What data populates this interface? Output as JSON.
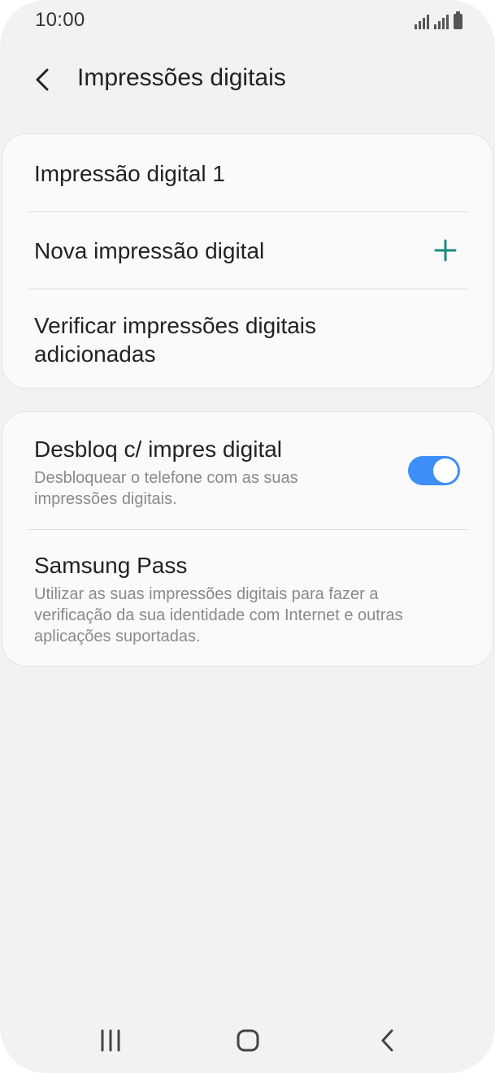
{
  "status_bar": {
    "time": "10:00"
  },
  "app_bar": {
    "title": "Impressões digitais",
    "back_icon": "chevron-left-icon"
  },
  "fingerprints_card": {
    "items": [
      {
        "label": "Impressão digital 1"
      },
      {
        "label": "Nova impressão digital",
        "icon": "plus-icon"
      },
      {
        "label": "Verificar impressões digitais adicionadas"
      }
    ]
  },
  "options_card": {
    "unlock": {
      "title": "Desbloq c/ impres digital",
      "subtitle": "Desbloquear o telefone com as suas impressões digitais.",
      "enabled": true
    },
    "samsung_pass": {
      "title": "Samsung Pass",
      "subtitle": "Utilizar as suas impressões digitais para fazer a verificação da sua identidade com Internet e outras aplicações suportadas."
    }
  },
  "colors": {
    "accent": "#3e8ef7",
    "plus": "#1a8b7f",
    "background": "#f2f2f2",
    "card": "#fafafa"
  },
  "nav_bar": {
    "recent_icon": "recent-apps-icon",
    "home_icon": "home-icon",
    "back_icon": "back-icon"
  }
}
